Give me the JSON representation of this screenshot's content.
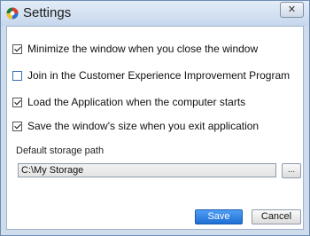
{
  "window": {
    "title": "Settings",
    "close_label": "✕"
  },
  "options": [
    {
      "label": "Minimize the window when you close the window",
      "checked": true
    },
    {
      "label": "Join in the Customer Experience Improvement Program",
      "checked": false
    },
    {
      "label": "Load the Application when the computer starts",
      "checked": true
    },
    {
      "label": "Save the window's size when you exit application",
      "checked": true
    }
  ],
  "storage": {
    "label": "Default storage path",
    "path": "C:\\My Storage",
    "browse_label": "..."
  },
  "buttons": {
    "save": "Save",
    "cancel": "Cancel"
  },
  "colors": {
    "accent": "#2a7be4",
    "titlebar": "#cfdcec"
  }
}
